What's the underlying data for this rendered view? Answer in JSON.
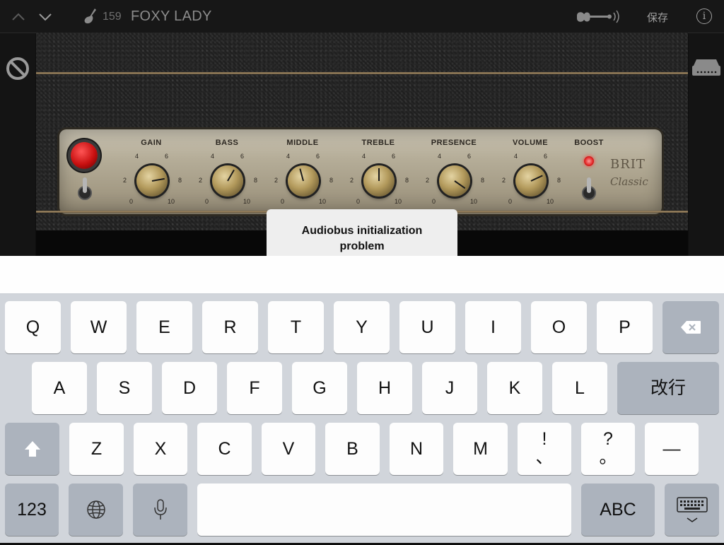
{
  "topbar": {
    "preset_number": "159",
    "preset_name": "FOXY LADY",
    "save_label": "保存",
    "info_label": "i"
  },
  "amp": {
    "knobs": [
      {
        "label": "GAIN",
        "ticks": [
          "4",
          "6",
          "2",
          "8",
          "0",
          "10"
        ]
      },
      {
        "label": "BASS",
        "ticks": [
          "4",
          "6",
          "2",
          "8",
          "0",
          "10"
        ]
      },
      {
        "label": "MIDDLE",
        "ticks": [
          "4",
          "6",
          "2",
          "8",
          "0",
          "10"
        ]
      },
      {
        "label": "TREBLE",
        "ticks": [
          "4",
          "6",
          "2",
          "8",
          "0",
          "10"
        ]
      },
      {
        "label": "PRESENCE",
        "ticks": [
          "4",
          "6",
          "2",
          "8",
          "0",
          "10"
        ]
      },
      {
        "label": "VOLUME",
        "ticks": [
          "4",
          "6",
          "2",
          "8",
          "0",
          "10"
        ]
      }
    ],
    "boost_label": "BOOST",
    "brand_top": "BRIT",
    "brand_bottom": "Classic"
  },
  "popup": {
    "line1": "Audiobus initialization",
    "line2": "problem"
  },
  "keyboard": {
    "row1": [
      "Q",
      "W",
      "E",
      "R",
      "T",
      "Y",
      "U",
      "I",
      "O",
      "P"
    ],
    "row2": [
      "A",
      "S",
      "D",
      "F",
      "G",
      "H",
      "J",
      "K",
      "L"
    ],
    "return_label": "改行",
    "row3": [
      "Z",
      "X",
      "C",
      "V",
      "B",
      "N",
      "M"
    ],
    "punct1_top": "!",
    "punct1_bottom": "、",
    "punct2_top": "?",
    "punct2_bottom": "。",
    "dash": "—",
    "numbers_label": "123",
    "abc_label": "ABC"
  }
}
